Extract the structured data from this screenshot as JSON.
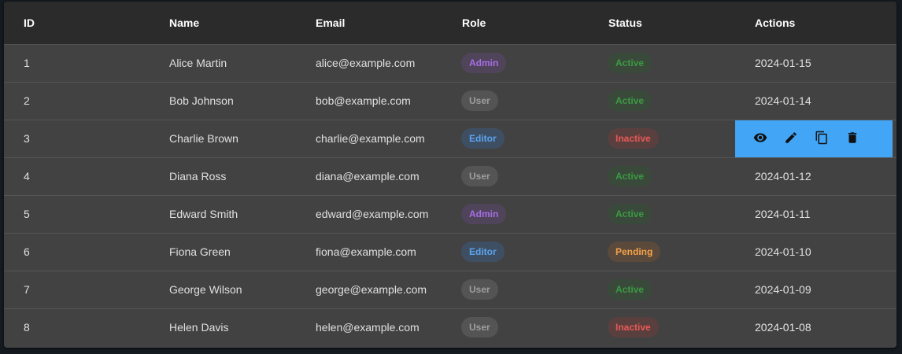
{
  "columns": [
    "ID",
    "Name",
    "Email",
    "Role",
    "Status",
    "Actions"
  ],
  "rows": [
    {
      "id": "1",
      "name": "Alice Martin",
      "email": "alice@example.com",
      "role": "Admin",
      "status": "Active",
      "date": "2024-01-15"
    },
    {
      "id": "2",
      "name": "Bob Johnson",
      "email": "bob@example.com",
      "role": "User",
      "status": "Active",
      "date": "2024-01-14"
    },
    {
      "id": "3",
      "name": "Charlie Brown",
      "email": "charlie@example.com",
      "role": "Editor",
      "status": "Inactive",
      "date": ""
    },
    {
      "id": "4",
      "name": "Diana Ross",
      "email": "diana@example.com",
      "role": "User",
      "status": "Active",
      "date": "2024-01-12"
    },
    {
      "id": "5",
      "name": "Edward Smith",
      "email": "edward@example.com",
      "role": "Admin",
      "status": "Active",
      "date": "2024-01-11"
    },
    {
      "id": "6",
      "name": "Fiona Green",
      "email": "fiona@example.com",
      "role": "Editor",
      "status": "Pending",
      "date": "2024-01-10"
    },
    {
      "id": "7",
      "name": "George Wilson",
      "email": "george@example.com",
      "role": "User",
      "status": "Active",
      "date": "2024-01-09"
    },
    {
      "id": "8",
      "name": "Helen Davis",
      "email": "helen@example.com",
      "role": "User",
      "status": "Inactive",
      "date": "2024-01-08"
    }
  ],
  "hover_row": {
    "index": 2,
    "actions": [
      {
        "name": "view-icon",
        "label": "view"
      },
      {
        "name": "edit-icon",
        "label": "edit"
      },
      {
        "name": "copy-icon",
        "label": "copy"
      },
      {
        "name": "delete-icon",
        "label": "delete"
      }
    ]
  },
  "colors": {
    "hover_actions_bg": "#42a5f5",
    "header_bg": "#2b2b2b",
    "row_bg": "#424242"
  }
}
